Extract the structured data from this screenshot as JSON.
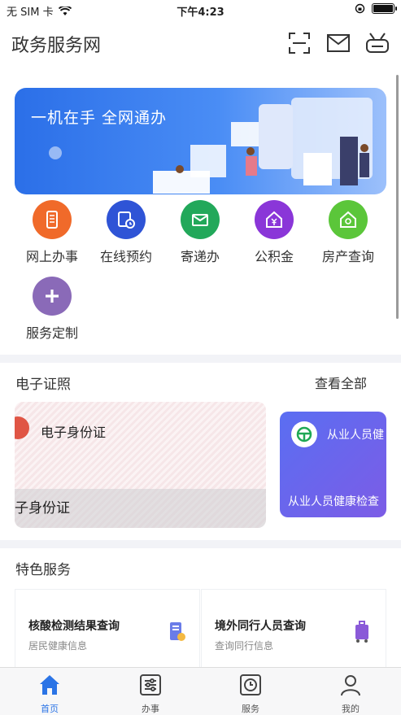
{
  "status_bar": {
    "carrier": "无 SIM 卡",
    "time": "下午4:23"
  },
  "header": {
    "title": "政务服务网"
  },
  "banner": {
    "text": "一机在手  全网通办"
  },
  "services": [
    {
      "label": "网上办事",
      "color": "#f06a2a",
      "icon": "phone-icon"
    },
    {
      "label": "在线预约",
      "color": "#2f54d6",
      "icon": "calendar-clock-icon"
    },
    {
      "label": "寄递办",
      "color": "#22a85a",
      "icon": "mail-icon"
    },
    {
      "label": "公积金",
      "color": "#8a36d8",
      "icon": "house-yen-icon"
    },
    {
      "label": "房产查询",
      "color": "#5bc63a",
      "icon": "house-search-icon"
    },
    {
      "label": "服务定制",
      "color": "#8a6ab8",
      "icon": "plus-icon"
    }
  ],
  "certificates": {
    "title": "电子证照",
    "view_all": "查看全部",
    "cards": [
      {
        "name": "电子身份证",
        "subtitle": "子身份证"
      },
      {
        "name": "从业人员健",
        "subtitle": "从业人员健康检查"
      }
    ]
  },
  "featured": {
    "title": "特色服务",
    "items": [
      {
        "title": "核酸检测结果查询",
        "subtitle": "居民健康信息"
      },
      {
        "title": "境外同行人员查询",
        "subtitle": "查询同行信息"
      }
    ]
  },
  "tabbar": {
    "tabs": [
      {
        "label": "首页",
        "active": true
      },
      {
        "label": "办事",
        "active": false
      },
      {
        "label": "服务",
        "active": false
      },
      {
        "label": "我的",
        "active": false
      }
    ]
  },
  "colors": {
    "accent": "#2b74e6",
    "banner_start": "#2b6fe8"
  }
}
